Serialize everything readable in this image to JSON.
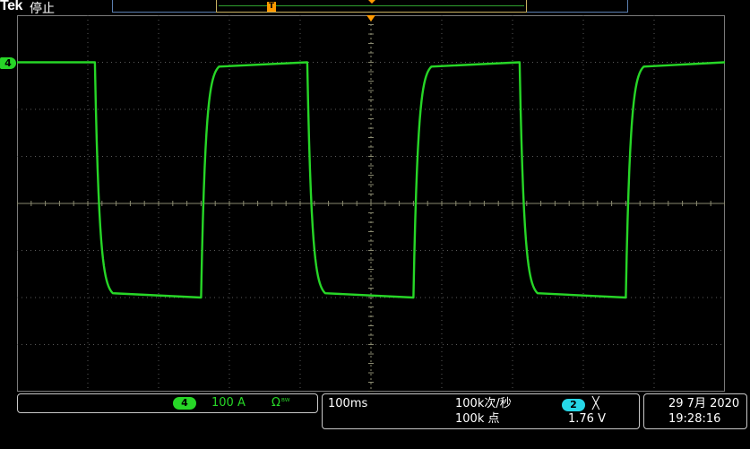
{
  "header": {
    "brand": "Tek",
    "status": "停止",
    "trigger_position_marker": "T"
  },
  "channel": {
    "number": "4",
    "color": "#27d627",
    "scale": "100 A",
    "impedance_symbol": "Ω",
    "bandwidth_symbol": "ᴮᵂ"
  },
  "horizontal": {
    "time_per_div": "100ms",
    "sample_rate": "100k次/秒",
    "record_length": "100k 点"
  },
  "trigger": {
    "source": "2",
    "source_color": "#26d6e6",
    "slope": "╳",
    "level": "1.76 V"
  },
  "datetime": {
    "date": "29 7月 2020",
    "time": "19:28:16"
  },
  "waveform": {
    "type": "square",
    "period_divisions": 3.0,
    "high_level_divisions": 3.0,
    "low_level_divisions": -2.0,
    "first_fall_division": 1.1
  }
}
